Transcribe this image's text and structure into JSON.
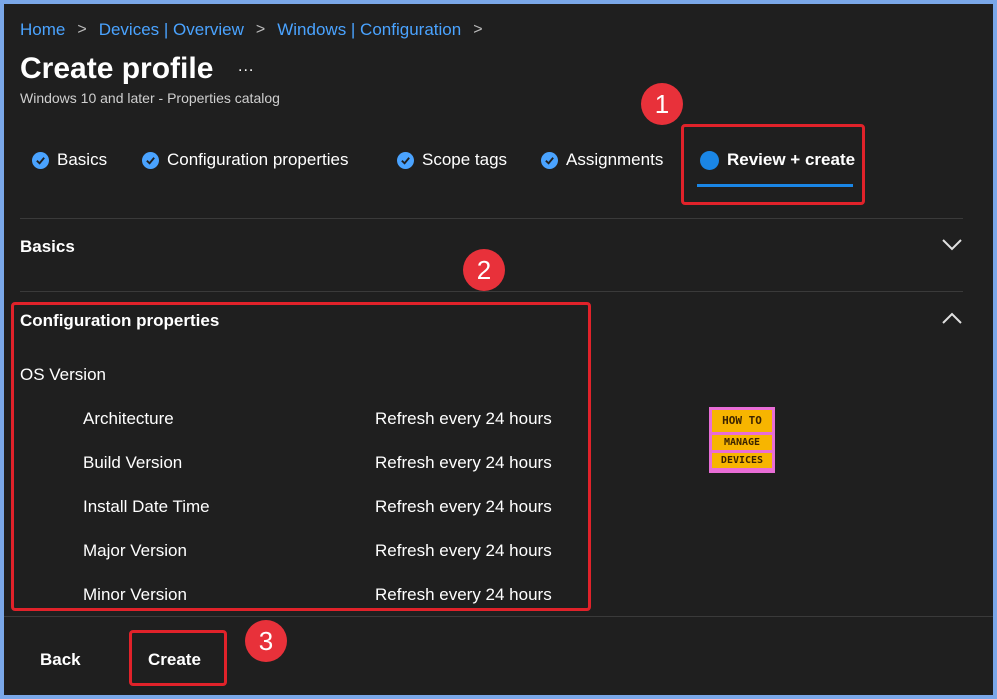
{
  "breadcrumb": {
    "items": [
      "Home",
      "Devices | Overview",
      "Windows | Configuration"
    ],
    "separator": ">"
  },
  "header": {
    "title": "Create profile",
    "more": "...",
    "subtitle": "Windows 10 and later - Properties catalog"
  },
  "wizard": {
    "steps": [
      {
        "label": "Basics",
        "state": "complete"
      },
      {
        "label": "Configuration properties",
        "state": "complete"
      },
      {
        "label": "Scope tags",
        "state": "complete"
      },
      {
        "label": "Assignments",
        "state": "complete"
      },
      {
        "label": "Review + create",
        "state": "active"
      }
    ]
  },
  "sections": {
    "basics": {
      "title": "Basics",
      "expanded": false
    },
    "config": {
      "title": "Configuration properties",
      "expanded": true,
      "group": "OS Version",
      "rows": [
        {
          "label": "Architecture",
          "value": "Refresh every 24 hours"
        },
        {
          "label": "Build Version",
          "value": "Refresh every 24 hours"
        },
        {
          "label": "Install Date Time",
          "value": "Refresh every 24 hours"
        },
        {
          "label": "Major Version",
          "value": "Refresh every 24 hours"
        },
        {
          "label": "Minor Version",
          "value": "Refresh every 24 hours"
        }
      ]
    }
  },
  "annotations": {
    "badge1": "1",
    "badge2": "2",
    "badge3": "3"
  },
  "logo": {
    "line1": "HOW TO",
    "line2": "MANAGE",
    "line3": "DEVICES"
  },
  "footer": {
    "back_label": "Back",
    "create_label": "Create"
  },
  "colors": {
    "background": "#1f1f1f",
    "link": "#4aa3ff",
    "accent": "#1a86e6",
    "highlight_box": "#e0222a",
    "badge": "#e8313a",
    "outer_border": "#7aa7e8"
  },
  "icons": {
    "step_complete": "check-circle-icon",
    "step_active": "dot-icon",
    "collapsed": "chevron-down-icon",
    "expanded": "chevron-up-icon"
  }
}
